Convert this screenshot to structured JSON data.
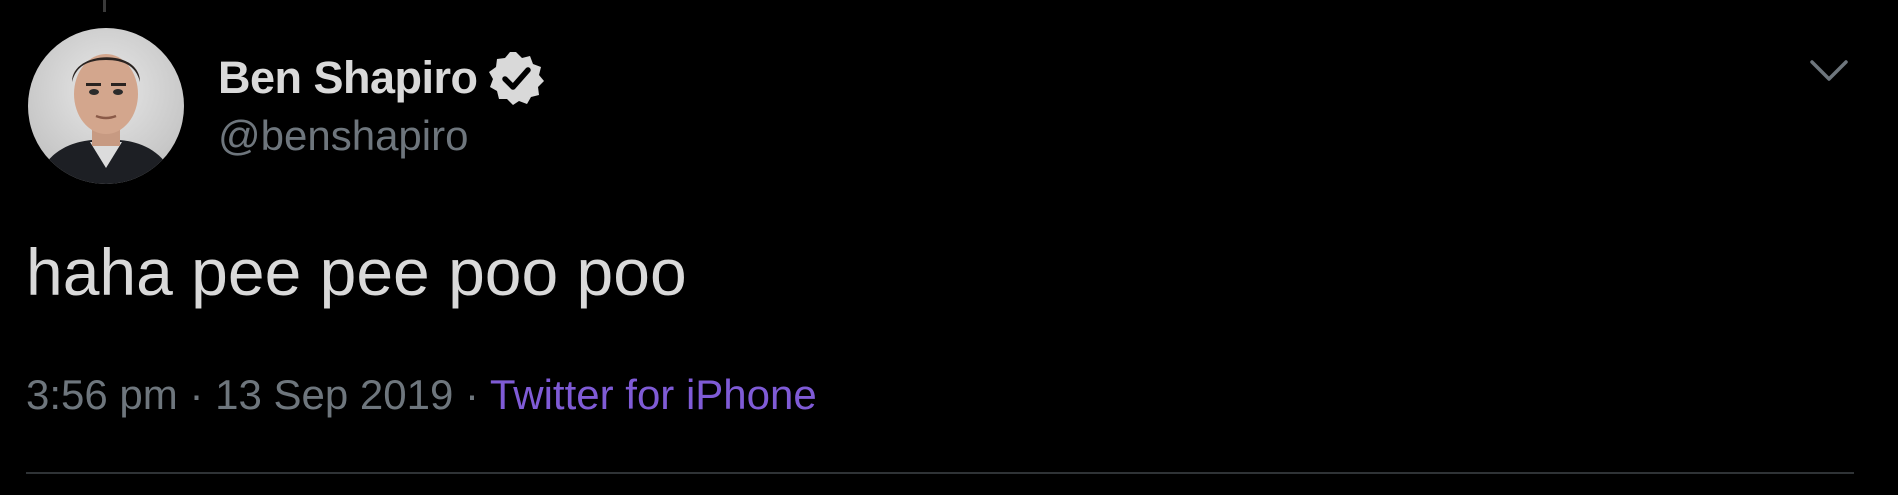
{
  "tweet": {
    "author": {
      "display_name": "Ben Shapiro",
      "handle": "@benshapiro",
      "verified": true,
      "avatar_icon": "person-avatar"
    },
    "text": "haha pee pee poo poo",
    "time": "3:56 pm",
    "separator": "·",
    "date": "13 Sep 2019",
    "source": "Twitter for iPhone",
    "more_icon": "chevron-down-icon"
  },
  "colors": {
    "background": "#000000",
    "text": "#d9d9d9",
    "muted": "#6e767d",
    "source_link": "#7f5bd6",
    "divider": "#2f3336"
  }
}
